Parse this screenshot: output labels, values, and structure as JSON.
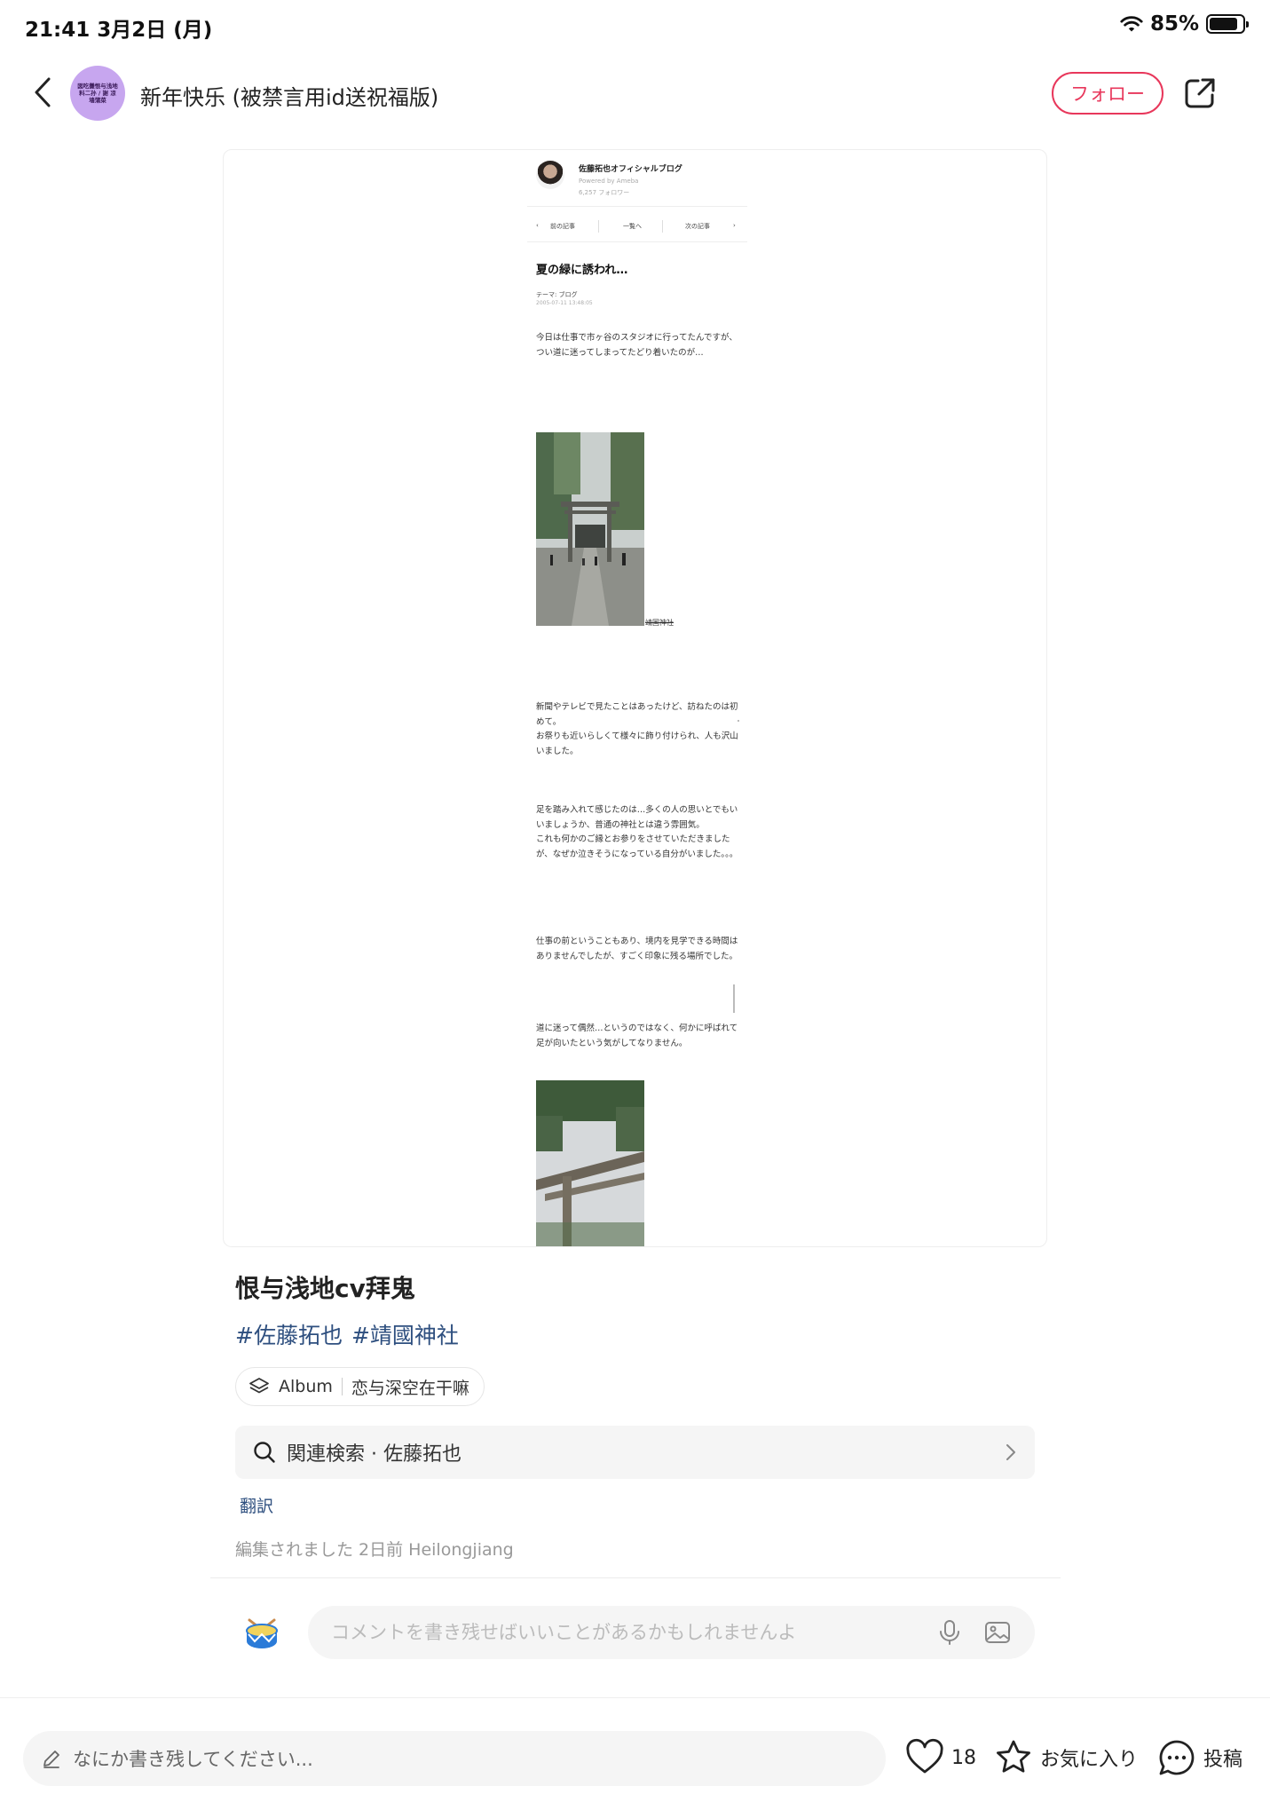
{
  "status_bar": {
    "time_date": "21:41  3月2日 (月)",
    "battery": "85%",
    "battery_level": 0.85
  },
  "header": {
    "avatar_text": "図吃攤恨与浅地 料二孙 / 謝 凉 墙蒲菜",
    "account_name": "新年快乐 (被禁言用id送祝福版)",
    "follow_label": "フォロー"
  },
  "blog": {
    "blog_title": "佐藤拓也オフィシャルブログ",
    "powered_by": "Powered by Ameba",
    "followers": "6,257 フォロワー",
    "nav_prev": "前の記事",
    "nav_list": "一覧へ",
    "nav_next": "次の記事",
    "post_title": "夏の緑に誘われ…",
    "theme": "テーマ: ブログ",
    "timestamp": "2005-07-11 13:48:05",
    "para1": "今日は仕事で市ヶ谷のスタジオに行ってたんですが、つい道に迷ってしまってたどり着いたのが…",
    "caption": "靖国神社",
    "para2": "新聞やテレビで見たことはあったけど、訪ねたのは初めて。\nお祭りも近いらしくて様々に飾り付けられ、人も沢山いました。",
    "para3": "足を踏み入れて感じたのは…多くの人の思いとでもいいましょうか、普通の神社とは違う雰囲気。\nこれも何かのご縁とお参りをさせていただきましたが、なぜか泣きそうになっている自分がいました。。。",
    "para4": "仕事の前ということもあり、境内を見学できる時間はありませんでしたが、すごく印象に残る場所でした。",
    "para5": "道に迷って偶然…というのではなく、何かに呼ばれて足が向いたという気がしてなりません。"
  },
  "post": {
    "title": "恨与浅地cv拜鬼",
    "hashtags": [
      "#佐藤拓也",
      "#靖國神社"
    ],
    "album_label": "Album",
    "album_name": "恋与深空在干嘛",
    "related_search": "関連検索 · 佐藤拓也",
    "translate": "翻訳",
    "edited_info": "編集されました 2日前 Heilongjiang"
  },
  "comment": {
    "placeholder": "コメントを書き残せばいいことがあるかもしれませんよ"
  },
  "bottom_bar": {
    "input_placeholder": "なにか書き残してください...",
    "like_count": "18",
    "favorite_label": "お気に入り",
    "post_label": "投稿"
  },
  "colors": {
    "accent": "#e8375b",
    "link": "#2e4f7f",
    "avatar_bg": "#c7a6ef"
  },
  "icons": [
    "back-icon",
    "share-icon",
    "wifi-icon",
    "battery-icon",
    "album-stack-icon",
    "search-icon",
    "chevron-right-icon",
    "drum-icon",
    "microphone-icon",
    "image-icon",
    "pencil-icon",
    "heart-icon",
    "star-icon",
    "comment-bubble-icon"
  ]
}
